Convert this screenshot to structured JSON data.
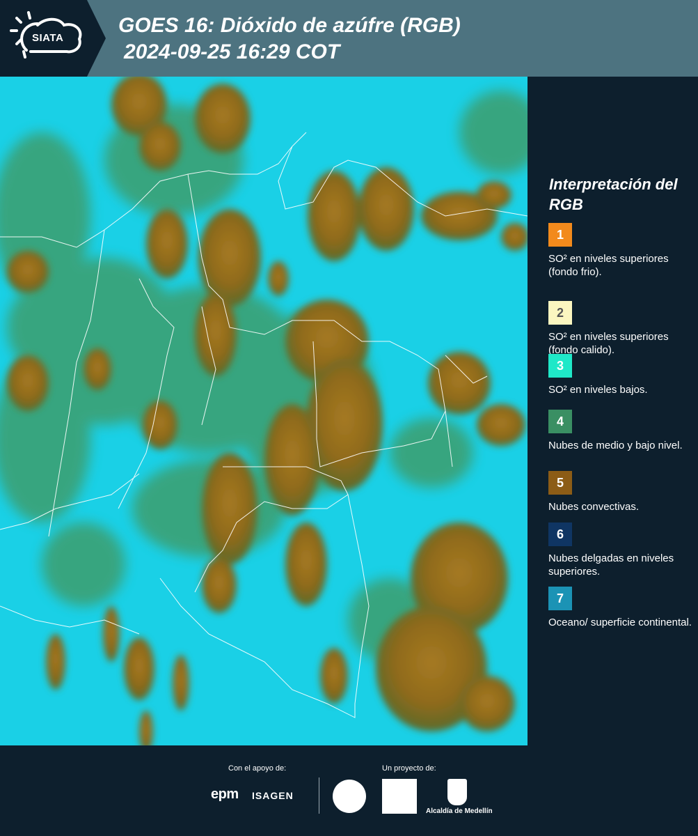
{
  "header": {
    "logo_text": "SIATA",
    "title_line1": "GOES 16: Dióxido de azúfre (RGB)",
    "title_line2": "2024-09-25 16:29 COT"
  },
  "map": {
    "description_icon": "satellite-rgb-map"
  },
  "legend": {
    "title": "Interpretación del RGB",
    "items": [
      {
        "number": "1",
        "color": "#f28a1c",
        "text": "SO² en niveles superiores (fondo frio)."
      },
      {
        "number": "2",
        "color": "#fbf6c0",
        "text": "SO² en niveles superiores (fondo calido)."
      },
      {
        "number": "3",
        "color": "#1fe8c8",
        "text": "SO² en niveles bajos."
      },
      {
        "number": "4",
        "color": "#3a8f63",
        "text": "Nubes de medio y bajo nivel."
      },
      {
        "number": "5",
        "color": "#8c5c16",
        "text": "Nubes convectivas."
      },
      {
        "number": "6",
        "color": "#0f3563",
        "text": "Nubes delgadas en niveles superiores."
      },
      {
        "number": "7",
        "color": "#1b93b5",
        "text": "Oceano/ superficie continental."
      }
    ]
  },
  "footer": {
    "support_label": "Con el apoyo de:",
    "project_label": "Un proyecto de:",
    "epm": "epm",
    "isagen": "ISAGEN",
    "alcaldia": "Alcaldía de Medellín"
  }
}
